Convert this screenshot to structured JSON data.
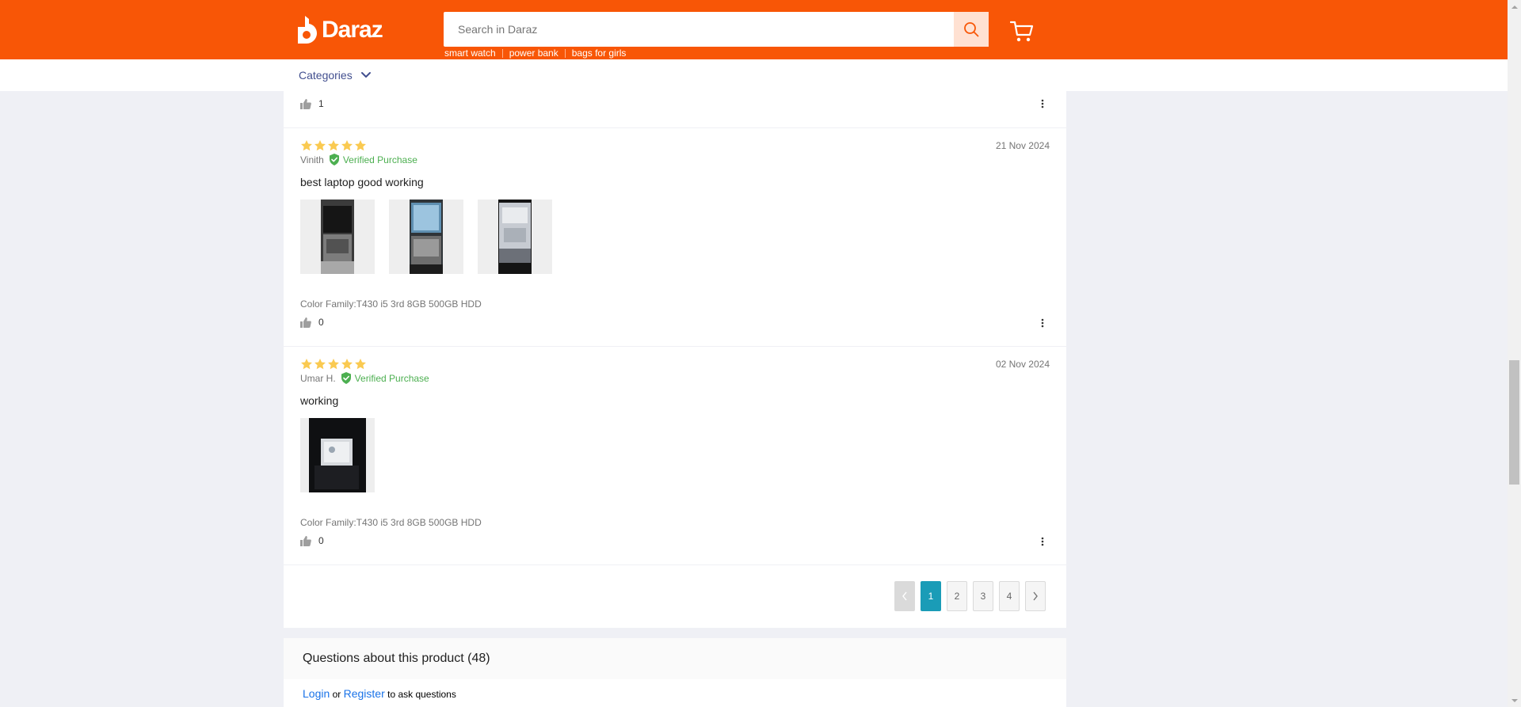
{
  "header": {
    "logo_text": "Daraz",
    "search_placeholder": "Search in Daraz",
    "keywords": [
      "smart watch",
      "power bank",
      "bags for girls"
    ],
    "categories_label": "Categories",
    "brand_color": "#f85606"
  },
  "reviews": {
    "top_partial": {
      "likes": "1"
    },
    "items": [
      {
        "rating": 5,
        "date": "21 Nov 2024",
        "author": "Vinith",
        "verified_label": "Verified Purchase",
        "content": "best laptop good working",
        "sku": "Color Family:T430 i5 3rd 8GB 500GB HDD",
        "likes": "0",
        "image_count": 3
      },
      {
        "rating": 5,
        "date": "02 Nov 2024",
        "author": "Umar H.",
        "verified_label": "Verified Purchase",
        "content": "working",
        "sku": "Color Family:T430 i5 3rd 8GB 500GB HDD",
        "likes": "0",
        "image_count": 1
      }
    ]
  },
  "pagination": {
    "pages": [
      "1",
      "2",
      "3",
      "4"
    ],
    "current": "1"
  },
  "questions": {
    "title": "Questions about this product (48)",
    "login_label": "Login",
    "or_label": "or",
    "register_label": "Register",
    "suffix": "to ask questions"
  }
}
